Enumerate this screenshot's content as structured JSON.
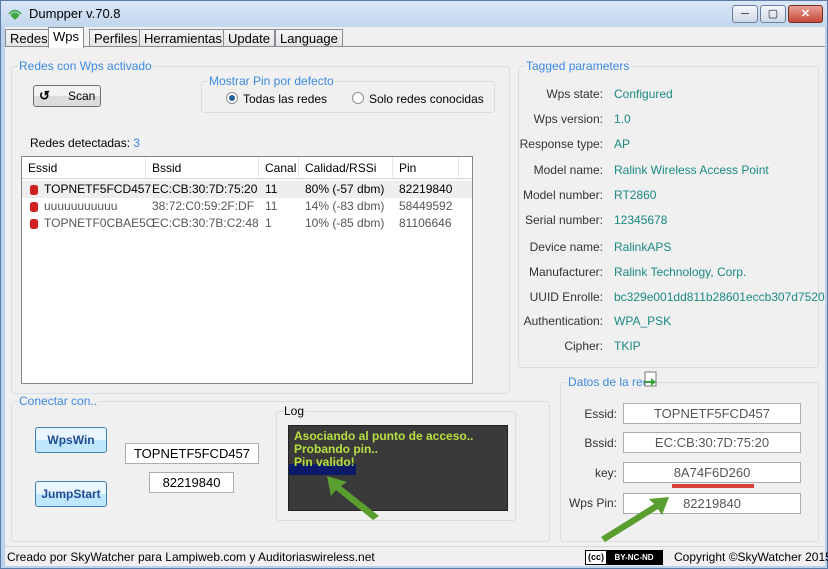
{
  "window": {
    "title": "Dumpper v.70.8",
    "min": "─",
    "max": "▢",
    "close": "✕"
  },
  "tabs": [
    "Redes",
    "Wps",
    "Perfiles",
    "Herramientas",
    "Update",
    "Language"
  ],
  "wps_group": {
    "label": "Redes con Wps activado",
    "scan": "Scan",
    "show_pin": {
      "label": "Mostrar Pin por defecto",
      "opt_all": "Todas las redes",
      "opt_known": "Solo redes conocidas"
    },
    "detected_label": "Redes detectadas:",
    "detected_count": "3",
    "columns": [
      "Essid",
      "Bssid",
      "Canal",
      "Calidad/RSSi",
      "Pin"
    ],
    "rows": [
      {
        "essid": "TOPNETF5FCD457",
        "bssid": "EC:CB:30:7D:75:20",
        "canal": "11",
        "calidad": "80% (-57 dbm)",
        "pin": "82219840"
      },
      {
        "essid": "uuuuuuuuuuu",
        "bssid": "38:72:C0:59:2F:DF",
        "canal": "11",
        "calidad": "14% (-83 dbm)",
        "pin": "58449592"
      },
      {
        "essid": "TOPNETF0CBAE5C",
        "bssid": "EC:CB:30:7B:C2:48",
        "canal": "1",
        "calidad": "10% (-85 dbm)",
        "pin": "81106646"
      }
    ]
  },
  "tagged": {
    "label": "Tagged parameters",
    "params": [
      {
        "key": "Wps state:",
        "value": "Configured"
      },
      {
        "key": "Wps version:",
        "value": "1.0"
      },
      {
        "key": "Response type:",
        "value": "AP"
      },
      {
        "key": "Model name:",
        "value": "Ralink Wireless Access Point"
      },
      {
        "key": "Model number:",
        "value": "RT2860"
      },
      {
        "key": "Serial number:",
        "value": "12345678"
      },
      {
        "key": "Device name:",
        "value": "RalinkAPS"
      },
      {
        "key": "Manufacturer:",
        "value": "Ralink Technology, Corp."
      },
      {
        "key": "UUID Enrolle:",
        "value": "bc329e001dd811b28601eccb307d7520"
      },
      {
        "key": "Authentication:",
        "value": "WPA_PSK"
      },
      {
        "key": "Cipher:",
        "value": "TKIP"
      }
    ]
  },
  "connect": {
    "label": "Conectar con..",
    "wpswin": "WpsWin",
    "jumpstart": "JumpStart",
    "essid_value": "TOPNETF5FCD457",
    "pin_value": "82219840"
  },
  "log": {
    "label": "Log",
    "lines": [
      "Asociando al punto de acceso..",
      "Probando pin..",
      "Pin valido!"
    ]
  },
  "datos": {
    "label": "Datos de la red",
    "essid_label": "Essid:",
    "essid": "TOPNETF5FCD457",
    "bssid_label": "Bssid:",
    "bssid": "EC:CB:30:7D:75:20",
    "key_label": "key:",
    "key": "8A74F6D260",
    "pin_label": "Wps Pin:",
    "pin": "82219840"
  },
  "status": {
    "left": "Creado por SkyWatcher para Lampiweb.com y Auditoriaswireless.net",
    "cc_left": "(cc)",
    "cc_right": "BY-NC-ND",
    "right": "Copyright ©SkyWatcher 2015"
  },
  "colors": {
    "accent_label": "#3c8ae0",
    "param_value": "#1a8a82",
    "log_text": "#b6e041",
    "arrow": "#5a9e2f",
    "key_underline": "#d9413a"
  }
}
